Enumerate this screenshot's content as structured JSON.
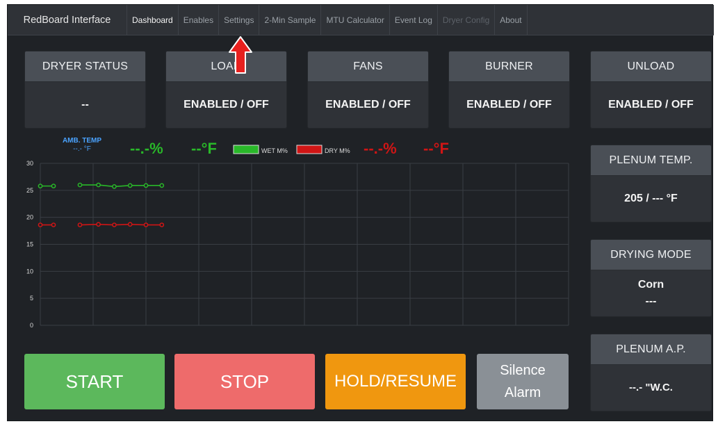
{
  "nav": {
    "brand": "RedBoard Interface",
    "items": [
      {
        "label": "Dashboard",
        "state": "active"
      },
      {
        "label": "Enables",
        "state": "normal"
      },
      {
        "label": "Settings",
        "state": "normal"
      },
      {
        "label": "2-Min Sample",
        "state": "normal"
      },
      {
        "label": "MTU Calculator",
        "state": "normal"
      },
      {
        "label": "Event Log",
        "state": "normal"
      },
      {
        "label": "Dryer Config",
        "state": "disabled"
      },
      {
        "label": "About",
        "state": "normal"
      }
    ]
  },
  "status_cards": [
    {
      "title": "DRYER STATUS",
      "value": "--"
    },
    {
      "title": "LOAD",
      "value": "ENABLED / OFF"
    },
    {
      "title": "FANS",
      "value": "ENABLED / OFF"
    },
    {
      "title": "BURNER",
      "value": "ENABLED / OFF"
    },
    {
      "title": "UNLOAD",
      "value": "ENABLED / OFF"
    }
  ],
  "side_cards": {
    "plenum_temp": {
      "title": "PLENUM TEMP.",
      "value": "205 / --- °F"
    },
    "drying_mode": {
      "title": "DRYING MODE",
      "line1": "Corn",
      "line2": "---"
    },
    "plenum_ap": {
      "title": "PLENUM A.P.",
      "value": "--.- \"W.C."
    }
  },
  "chart_header": {
    "amb_temp_label": "AMB. TEMP",
    "amb_temp_value": "--.- °F",
    "wet_moisture": "--.-%",
    "wet_temp": "--°F",
    "wet_legend": "WET M%",
    "dry_legend": "DRY M%",
    "dry_moisture": "--.-%",
    "dry_temp": "--°F"
  },
  "buttons": {
    "start": "START",
    "stop": "STOP",
    "hold": "HOLD/RESUME",
    "silence_line1": "Silence",
    "silence_line2": "Alarm"
  },
  "colors": {
    "wet": "#29b829",
    "dry": "#d01515",
    "amb": "#4aa3ff",
    "start": "#5cb85c",
    "stop": "#ee6b6b",
    "hold": "#f0970f",
    "silence": "#8a9096",
    "arrow": "#e8201e"
  },
  "chart_data": {
    "type": "line",
    "ylim": [
      0,
      30
    ],
    "y_ticks": [
      0,
      5,
      10,
      15,
      20,
      25,
      30
    ],
    "vertical_gridlines": 10,
    "series": [
      {
        "name": "WET M%",
        "color": "#29b829",
        "segments": [
          [
            [
              0.0,
              25.8
            ],
            [
              0.5,
              25.8
            ]
          ],
          [
            [
              1.5,
              26.0
            ],
            [
              2.2,
              26.0
            ],
            [
              2.8,
              25.7
            ],
            [
              3.4,
              25.9
            ],
            [
              4.0,
              25.9
            ],
            [
              4.6,
              25.9
            ]
          ]
        ]
      },
      {
        "name": "DRY M%",
        "color": "#d01515",
        "segments": [
          [
            [
              0.0,
              18.6
            ],
            [
              0.5,
              18.6
            ]
          ],
          [
            [
              1.5,
              18.6
            ],
            [
              2.2,
              18.7
            ],
            [
              2.8,
              18.6
            ],
            [
              3.4,
              18.7
            ],
            [
              4.0,
              18.6
            ],
            [
              4.6,
              18.6
            ]
          ]
        ]
      }
    ]
  }
}
